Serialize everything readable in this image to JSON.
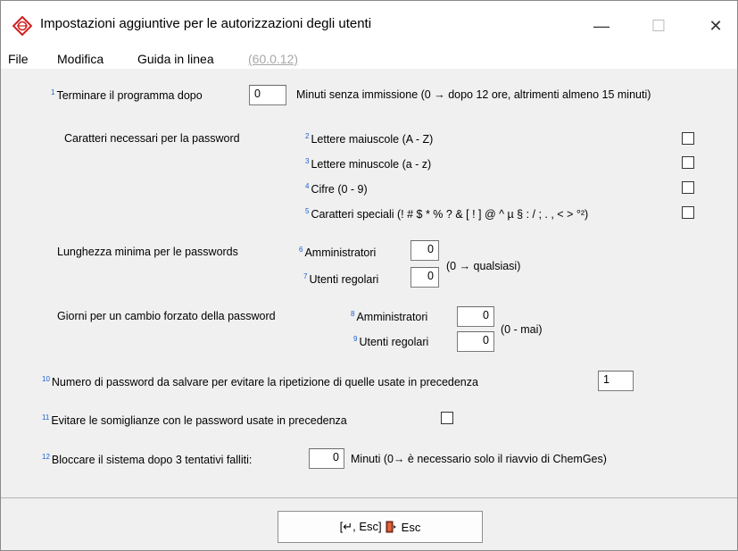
{
  "window": {
    "title": "Impostazioni aggiuntive per le autorizzazioni degli utenti",
    "minimize": "—",
    "maximize": "☐",
    "close": "✕"
  },
  "menu": {
    "file": "File",
    "modifica": "Modifica",
    "guida": "Guida in linea",
    "version": "(60.0.12)"
  },
  "row1": {
    "num": "1",
    "label": "Terminare il programma dopo",
    "value": "0",
    "suffix": "Minuti senza immissione (0 → dopo 12 ore, altrimenti almeno 15 minuti)"
  },
  "password_chars": {
    "label": "Caratteri necessari per la password",
    "items": [
      {
        "num": "2",
        "label": "Lettere maiuscole (A - Z)",
        "checked": false
      },
      {
        "num": "3",
        "label": "Lettere minuscole (a - z)",
        "checked": false
      },
      {
        "num": "4",
        "label": "Cifre (0 - 9)",
        "checked": false
      },
      {
        "num": "5",
        "label": "Caratteri speciali (! # $ * % ? & [ ! ] @ ^ µ § : / ; . , < > °²)",
        "checked": false
      }
    ]
  },
  "min_length": {
    "label": "Lunghezza minima per le passwords",
    "admin_num": "6",
    "admin_label": "Amministratori",
    "admin_value": "0",
    "users_num": "7",
    "users_label": "Utenti regolari",
    "users_value": "0",
    "note": "(0 → qualsiasi)"
  },
  "force_change": {
    "label": "Giorni per un cambio forzato della password",
    "admin_num": "8",
    "admin_label": "Amministratori",
    "admin_value": "0",
    "users_num": "9",
    "users_label": "Utenti regolari",
    "users_value": "0",
    "note": "(0 - mai)"
  },
  "row10": {
    "num": "10",
    "label": "Numero di password da salvare per evitare la ripetizione di quelle usate in precedenza",
    "value": "1"
  },
  "row11": {
    "num": "11",
    "label": "Evitare le somiglianze con le password usate in precedenza",
    "checked": false
  },
  "row12": {
    "num": "12",
    "label": "Bloccare il sistema dopo 3 tentativi falliti:",
    "value": "0",
    "suffix": "Minuti (0→ è necessario solo il riavvio di ChemGes)"
  },
  "footer": {
    "button_prefix": "[↵, Esc]",
    "button_label": "Esc",
    "button_icon": "exit-door-icon"
  }
}
